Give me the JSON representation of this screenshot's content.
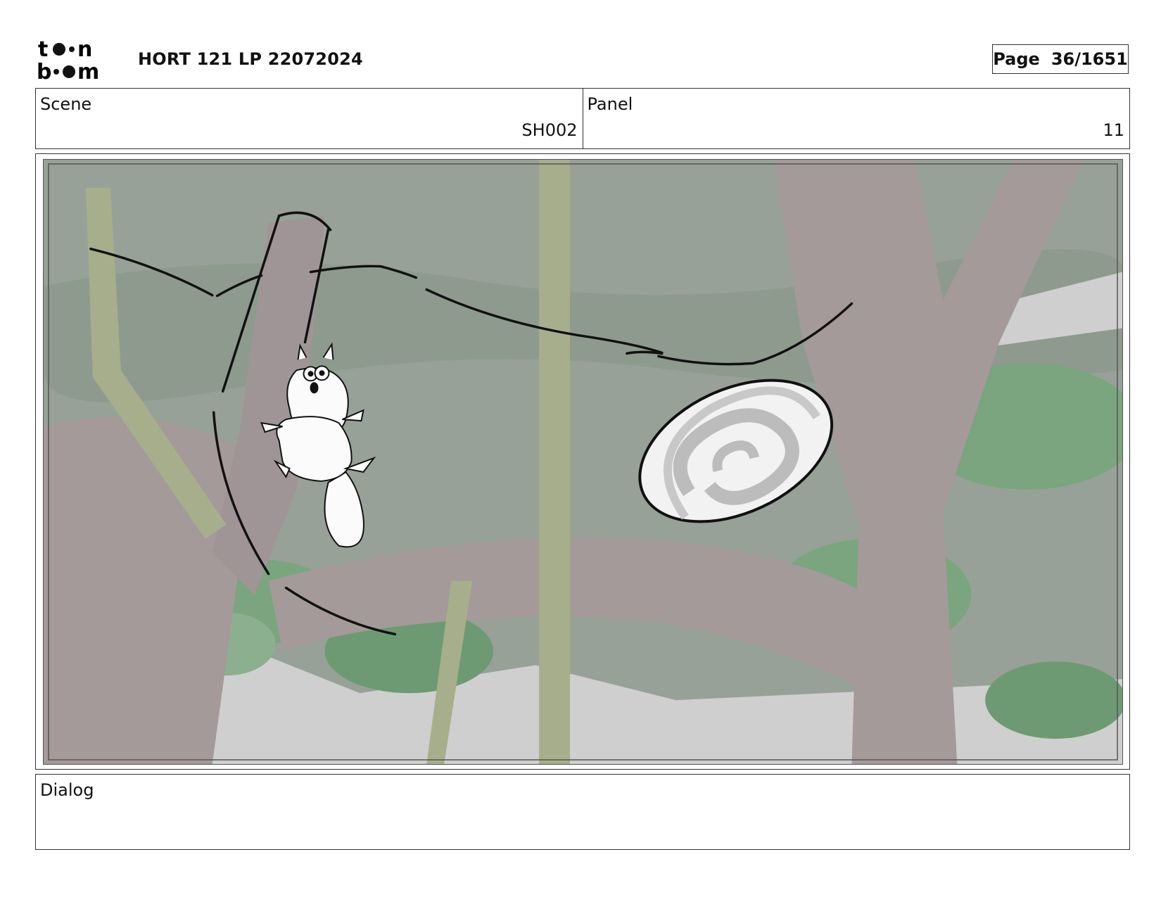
{
  "header": {
    "logo_text": "toon boom",
    "title": "HORT 121 LP 22072024",
    "page_label": "Page",
    "page_value": "36/1651"
  },
  "scene": {
    "label": "Scene",
    "value": "SH002"
  },
  "panel": {
    "label": "Panel",
    "value": "11"
  },
  "dialog": {
    "label": "Dialog",
    "value": ""
  },
  "artwork": {
    "description_icon": "storyboard-frame-squirrel-in-forest",
    "colors": {
      "sky": "#97a197",
      "trunk": "#a39a99",
      "foliage": "#7aa57e",
      "vine": "#a7ae8c",
      "ink": "#111111"
    }
  }
}
